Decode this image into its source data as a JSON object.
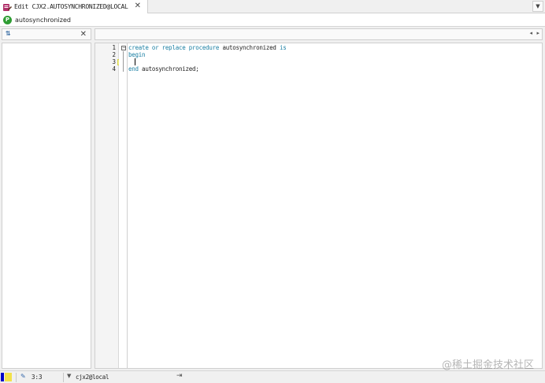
{
  "tab": {
    "title": "Edit CJX2.AUTOSYNCHRONIZED@LOCAL",
    "close_glyph": "✕",
    "icon": "procedure-edit-icon"
  },
  "tab_menu_glyph": "▼",
  "object_bar": {
    "icon_letter": "P",
    "label": "autosynchronized",
    "icon_color": "#2f9d33"
  },
  "left_panel": {
    "sort_glyph": "⇅",
    "close_glyph": "✕"
  },
  "editor_nav": {
    "prev_glyph": "◂",
    "next_glyph": "▸"
  },
  "editor": {
    "line_numbers": [
      "1",
      "2",
      "3",
      "4"
    ],
    "lines": [
      [
        {
          "t": "create",
          "k": "kw"
        },
        {
          "t": " or ",
          "k": "kw"
        },
        {
          "t": "replace",
          "k": "kw"
        },
        {
          "t": " procedure ",
          "k": "kw"
        },
        {
          "t": "autosynchronized",
          "k": "id"
        },
        {
          "t": " is",
          "k": "kw"
        }
      ],
      [
        {
          "t": "begin",
          "k": "kw"
        }
      ],
      [
        {
          "t": "  ",
          "k": "id"
        }
      ],
      [
        {
          "t": "end",
          "k": "kw"
        },
        {
          "t": " autosynchronized;",
          "k": "id"
        }
      ]
    ],
    "fold_glyph": "⊟",
    "keyword_color": "#1a7fa3"
  },
  "status": {
    "position": "3:3",
    "connection": "cjx2@local",
    "edit_glyph": "✎",
    "dropdown_glyph": "▼",
    "pin_glyph": "⇥"
  },
  "watermark": "@稀土掘金技术社区"
}
